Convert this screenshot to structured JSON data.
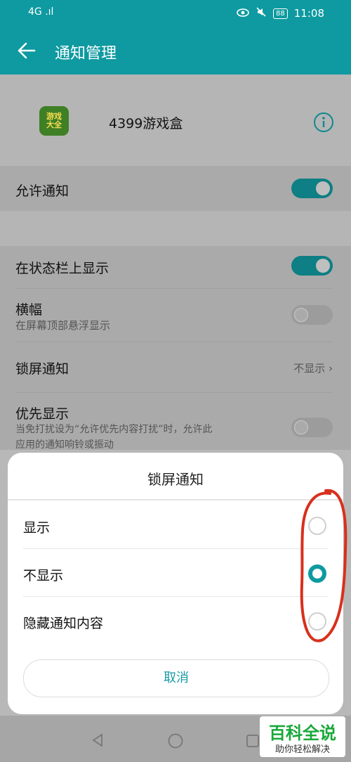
{
  "status_bar": {
    "left_text": "4G .ıl",
    "time": "11:08",
    "battery": "88"
  },
  "app_bar": {
    "title": "通知管理"
  },
  "app": {
    "name": "4399游戏盒",
    "icon_text_line1": "游戏",
    "icon_text_line2": "大全",
    "icon_color": "#3f7f25"
  },
  "settings": {
    "allow_notifications": {
      "label": "允许通知",
      "on": true
    },
    "status_bar_show": {
      "label": "在状态栏上显示",
      "on": true
    },
    "banner": {
      "label": "横幅",
      "sub": "在屏幕顶部悬浮显示",
      "on": false
    },
    "lock_screen": {
      "label": "锁屏通知",
      "value": "不显示"
    },
    "priority": {
      "label": "优先显示",
      "sub_line1": "当免打扰设为“允许优先内容打扰”时，允许此",
      "sub_line2": "应用的通知响铃或振动",
      "on": false
    }
  },
  "dialog": {
    "title": "锁屏通知",
    "options": [
      {
        "label": "显示",
        "checked": false
      },
      {
        "label": "不显示",
        "checked": true
      },
      {
        "label": "隐藏通知内容",
        "checked": false
      }
    ],
    "cancel_label": "取消"
  },
  "watermark": {
    "title": "百科全说",
    "subtitle": "助你轻松解决"
  },
  "colors": {
    "accent": "#0e9aa0",
    "annotation": "#d8301c"
  }
}
